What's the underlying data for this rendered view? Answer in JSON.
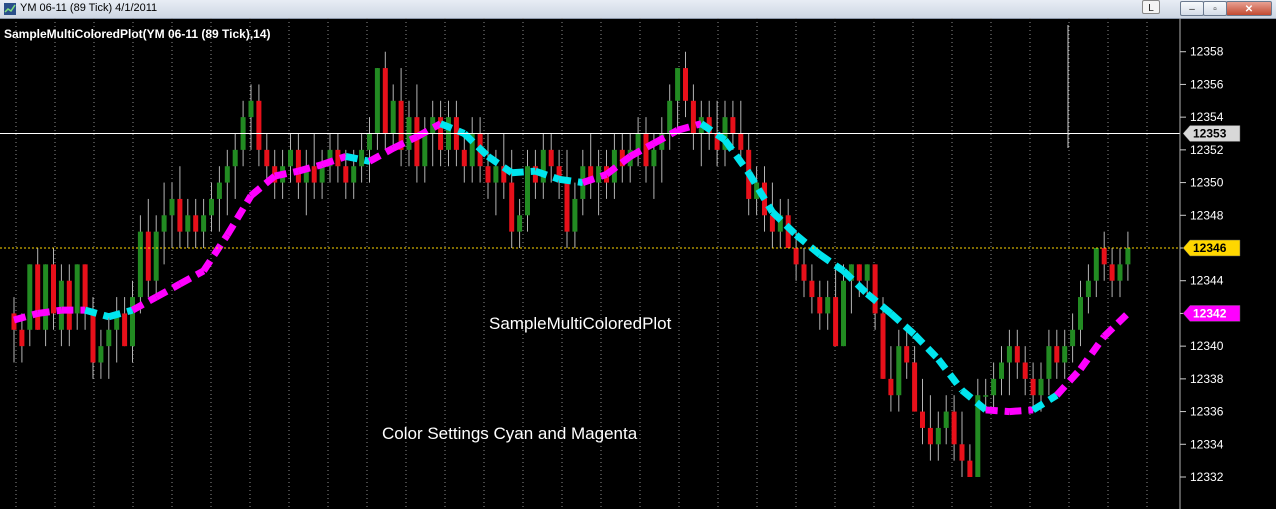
{
  "window": {
    "title": "YM 06-11 (89 Tick)  4/1/2011",
    "btn_l": "L",
    "btn_min": "–",
    "btn_max": "▫",
    "btn_close": "✕"
  },
  "colors": {
    "background": "#000000",
    "up_bar": "#228B22",
    "down_bar": "#E8101A",
    "wick": "#B4B4B4",
    "cyan": "#00E5EE",
    "magenta": "#FF00FF",
    "last_price": "#FFD700",
    "grid": "#8C8C8C",
    "crosshair": "#FFFFFF"
  },
  "chart_data": {
    "type": "candlestick",
    "title": "SampleMultiColoredPlot(YM 06-11 (89 Tick),14)",
    "annotations": [
      "SampleMultiColoredPlot",
      "Color Settings Cyan and Magenta"
    ],
    "ylim": [
      12331.1,
      12359.2
    ],
    "y_ticks": [
      12332,
      12334,
      12336,
      12338,
      12340,
      12342,
      12344,
      12346,
      12348,
      12350,
      12352,
      12354,
      12356,
      12358
    ],
    "y_tick_labels": [
      "12332",
      "12334",
      "12336",
      "12338",
      "12340",
      "12342",
      "12344",
      "12346",
      "12348",
      "12350",
      "12352",
      "12354",
      "12356",
      "12358"
    ],
    "price_markers": [
      {
        "label": "12353",
        "value": 12353,
        "style": "crosshair"
      },
      {
        "label": "12346",
        "value": 12346,
        "style": "last"
      },
      {
        "label": "12342",
        "value": 12342,
        "style": "magenta"
      }
    ],
    "bars": [
      [
        12342,
        12343,
        12339,
        12341
      ],
      [
        12341,
        12342,
        12339,
        12340
      ],
      [
        12341,
        12345,
        12340,
        12345
      ],
      [
        12345,
        12346,
        12341,
        12341
      ],
      [
        12341,
        12345,
        12340,
        12345
      ],
      [
        12345,
        12346,
        12341,
        12342
      ],
      [
        12341,
        12345,
        12340,
        12344
      ],
      [
        12344,
        12345,
        12340,
        12341
      ],
      [
        12342,
        12345,
        12341,
        12345
      ],
      [
        12345,
        12345,
        12341,
        12342
      ],
      [
        12342,
        12343,
        12338,
        12339
      ],
      [
        12339,
        12341,
        12338,
        12340
      ],
      [
        12340,
        12342,
        12338,
        12341
      ],
      [
        12341,
        12343,
        12339,
        12342
      ],
      [
        12342,
        12343,
        12340,
        12340
      ],
      [
        12340,
        12344,
        12339,
        12343
      ],
      [
        12343,
        12348,
        12342,
        12347
      ],
      [
        12347,
        12349,
        12343,
        12344
      ],
      [
        12344,
        12348,
        12343,
        12347
      ],
      [
        12347,
        12350,
        12345,
        12348
      ],
      [
        12348,
        12350,
        12346,
        12349
      ],
      [
        12349,
        12351,
        12346,
        12347
      ],
      [
        12347,
        12349,
        12346,
        12348
      ],
      [
        12348,
        12349,
        12346,
        12347
      ],
      [
        12347,
        12349,
        12346,
        12348
      ],
      [
        12348,
        12350,
        12347,
        12349
      ],
      [
        12349,
        12351,
        12347,
        12350
      ],
      [
        12350,
        12352,
        12348,
        12351
      ],
      [
        12351,
        12353,
        12349,
        12352
      ],
      [
        12352,
        12355,
        12351,
        12354
      ],
      [
        12354,
        12356,
        12352,
        12355
      ],
      [
        12355,
        12356,
        12351,
        12352
      ],
      [
        12352,
        12353,
        12350,
        12351
      ],
      [
        12351,
        12352,
        12349,
        12350
      ],
      [
        12350,
        12352,
        12349,
        12351
      ],
      [
        12351,
        12353,
        12350,
        12352
      ],
      [
        12352,
        12353,
        12349,
        12350
      ],
      [
        12350,
        12352,
        12348,
        12351
      ],
      [
        12351,
        12353,
        12349,
        12350
      ],
      [
        12350,
        12352,
        12349,
        12351
      ],
      [
        12351,
        12353,
        12350,
        12352
      ],
      [
        12352,
        12353,
        12350,
        12351
      ],
      [
        12351,
        12352,
        12349,
        12350
      ],
      [
        12350,
        12352,
        12349,
        12351
      ],
      [
        12351,
        12353,
        12350,
        12352
      ],
      [
        12352,
        12354,
        12350,
        12353
      ],
      [
        12353,
        12357,
        12352,
        12357
      ],
      [
        12357,
        12358,
        12352,
        12353
      ],
      [
        12353,
        12356,
        12352,
        12355
      ],
      [
        12355,
        12357,
        12351,
        12352
      ],
      [
        12352,
        12355,
        12351,
        12354
      ],
      [
        12354,
        12356,
        12350,
        12351
      ],
      [
        12351,
        12354,
        12350,
        12353
      ],
      [
        12353,
        12355,
        12351,
        12354
      ],
      [
        12354,
        12355,
        12351,
        12352
      ],
      [
        12352,
        12355,
        12351,
        12354
      ],
      [
        12354,
        12355,
        12351,
        12352
      ],
      [
        12352,
        12353,
        12350,
        12351
      ],
      [
        12351,
        12354,
        12350,
        12353
      ],
      [
        12353,
        12354,
        12350,
        12351
      ],
      [
        12351,
        12353,
        12349,
        12350
      ],
      [
        12350,
        12352,
        12348,
        12351
      ],
      [
        12351,
        12353,
        12349,
        12350
      ],
      [
        12350,
        12352,
        12346,
        12347
      ],
      [
        12347,
        12349,
        12346,
        12348
      ],
      [
        12348,
        12352,
        12347,
        12351
      ],
      [
        12351,
        12352,
        12349,
        12350
      ],
      [
        12350,
        12353,
        12349,
        12352
      ],
      [
        12352,
        12353,
        12350,
        12351
      ],
      [
        12351,
        12352,
        12349,
        12350
      ],
      [
        12350,
        12352,
        12346,
        12347
      ],
      [
        12347,
        12350,
        12346,
        12349
      ],
      [
        12349,
        12352,
        12348,
        12351
      ],
      [
        12351,
        12353,
        12349,
        12350
      ],
      [
        12350,
        12352,
        12348,
        12351
      ],
      [
        12351,
        12352,
        12349,
        12350
      ],
      [
        12350,
        12353,
        12349,
        12352
      ],
      [
        12352,
        12353,
        12350,
        12351
      ],
      [
        12351,
        12353,
        12350,
        12352
      ],
      [
        12352,
        12354,
        12351,
        12353
      ],
      [
        12353,
        12354,
        12350,
        12351
      ],
      [
        12351,
        12353,
        12349,
        12352
      ],
      [
        12352,
        12354,
        12350,
        12353
      ],
      [
        12353,
        12356,
        12352,
        12355
      ],
      [
        12355,
        12357,
        12353,
        12357
      ],
      [
        12357,
        12358,
        12354,
        12355
      ],
      [
        12355,
        12356,
        12352,
        12353
      ],
      [
        12353,
        12355,
        12351,
        12354
      ],
      [
        12354,
        12355,
        12352,
        12353
      ],
      [
        12353,
        12355,
        12351,
        12352
      ],
      [
        12352,
        12355,
        12351,
        12354
      ],
      [
        12354,
        12355,
        12352,
        12353
      ],
      [
        12353,
        12355,
        12351,
        12352
      ],
      [
        12352,
        12353,
        12348,
        12349
      ],
      [
        12349,
        12351,
        12348,
        12350
      ],
      [
        12350,
        12351,
        12347,
        12348
      ],
      [
        12348,
        12350,
        12346,
        12347
      ],
      [
        12347,
        12349,
        12346,
        12348
      ],
      [
        12348,
        12349,
        12346,
        12346
      ],
      [
        12346,
        12347,
        12344,
        12345
      ],
      [
        12345,
        12346,
        12343,
        12344
      ],
      [
        12344,
        12345,
        12342,
        12343
      ],
      [
        12343,
        12344,
        12341,
        12342
      ],
      [
        12342,
        12344,
        12341,
        12343
      ],
      [
        12343,
        12345,
        12340,
        12340
      ],
      [
        12340,
        12345,
        12340,
        12344
      ],
      [
        12344,
        12345,
        12342,
        12345
      ],
      [
        12345,
        12345,
        12343,
        12344
      ],
      [
        12344,
        12345,
        12343,
        12345
      ],
      [
        12345,
        12345,
        12341,
        12342
      ],
      [
        12342,
        12343,
        12338,
        12338
      ],
      [
        12338,
        12340,
        12336,
        12337
      ],
      [
        12337,
        12341,
        12336,
        12340
      ],
      [
        12340,
        12341,
        12338,
        12339
      ],
      [
        12339,
        12340,
        12336,
        12336
      ],
      [
        12336,
        12338,
        12334,
        12335
      ],
      [
        12335,
        12337,
        12333,
        12334
      ],
      [
        12334,
        12336,
        12333,
        12335
      ],
      [
        12335,
        12337,
        12334,
        12336
      ],
      [
        12336,
        12337,
        12333,
        12334
      ],
      [
        12334,
        12336,
        12332,
        12333
      ],
      [
        12333,
        12334,
        12332,
        12332
      ],
      [
        12332,
        12338,
        12332,
        12337
      ],
      [
        12337,
        12338,
        12336,
        12337
      ],
      [
        12337,
        12339,
        12336,
        12338
      ],
      [
        12338,
        12340,
        12337,
        12339
      ],
      [
        12339,
        12341,
        12337,
        12340
      ],
      [
        12340,
        12341,
        12338,
        12339
      ],
      [
        12339,
        12340,
        12337,
        12338
      ],
      [
        12338,
        12339,
        12336,
        12337
      ],
      [
        12337,
        12339,
        12336,
        12338
      ],
      [
        12338,
        12341,
        12337,
        12340
      ],
      [
        12340,
        12341,
        12338,
        12339
      ],
      [
        12339,
        12341,
        12338,
        12340
      ],
      [
        12340,
        12342,
        12339,
        12341
      ],
      [
        12341,
        12344,
        12340,
        12343
      ],
      [
        12343,
        12345,
        12342,
        12344
      ],
      [
        12344,
        12346,
        12343,
        12346
      ],
      [
        12346,
        12347,
        12344,
        12345
      ],
      [
        12345,
        12346,
        12343,
        12344
      ],
      [
        12344,
        12346,
        12343,
        12345
      ],
      [
        12345,
        12347,
        12344,
        12346
      ]
    ],
    "ma_line": [
      {
        "x": 0,
        "y": 12341.6,
        "color": "magenta"
      },
      {
        "x": 3,
        "y": 12342.0,
        "color": "magenta"
      },
      {
        "x": 6,
        "y": 12342.2,
        "color": "magenta"
      },
      {
        "x": 9,
        "y": 12342.2,
        "color": "cyan"
      },
      {
        "x": 12,
        "y": 12341.8,
        "color": "cyan"
      },
      {
        "x": 15,
        "y": 12342.2,
        "color": "magenta"
      },
      {
        "x": 18,
        "y": 12343.0,
        "color": "magenta"
      },
      {
        "x": 21,
        "y": 12343.8,
        "color": "magenta"
      },
      {
        "x": 24,
        "y": 12344.6,
        "color": "magenta"
      },
      {
        "x": 27,
        "y": 12346.8,
        "color": "magenta"
      },
      {
        "x": 30,
        "y": 12349.2,
        "color": "magenta"
      },
      {
        "x": 33,
        "y": 12350.4,
        "color": "magenta"
      },
      {
        "x": 36,
        "y": 12350.7,
        "color": "magenta"
      },
      {
        "x": 39,
        "y": 12351.1,
        "color": "magenta"
      },
      {
        "x": 42,
        "y": 12351.6,
        "color": "cyan"
      },
      {
        "x": 45,
        "y": 12351.3,
        "color": "magenta"
      },
      {
        "x": 48,
        "y": 12352.1,
        "color": "magenta"
      },
      {
        "x": 51,
        "y": 12352.8,
        "color": "magenta"
      },
      {
        "x": 54,
        "y": 12353.6,
        "color": "cyan"
      },
      {
        "x": 57,
        "y": 12353.0,
        "color": "cyan"
      },
      {
        "x": 60,
        "y": 12351.6,
        "color": "cyan"
      },
      {
        "x": 63,
        "y": 12350.6,
        "color": "cyan"
      },
      {
        "x": 66,
        "y": 12350.7,
        "color": "cyan"
      },
      {
        "x": 69,
        "y": 12350.2,
        "color": "cyan"
      },
      {
        "x": 72,
        "y": 12350.0,
        "color": "magenta"
      },
      {
        "x": 75,
        "y": 12350.5,
        "color": "magenta"
      },
      {
        "x": 78,
        "y": 12351.6,
        "color": "magenta"
      },
      {
        "x": 81,
        "y": 12352.4,
        "color": "magenta"
      },
      {
        "x": 84,
        "y": 12353.2,
        "color": "magenta"
      },
      {
        "x": 87,
        "y": 12353.6,
        "color": "cyan"
      },
      {
        "x": 90,
        "y": 12352.6,
        "color": "cyan"
      },
      {
        "x": 93,
        "y": 12350.6,
        "color": "cyan"
      },
      {
        "x": 96,
        "y": 12348.2,
        "color": "cyan"
      },
      {
        "x": 99,
        "y": 12346.8,
        "color": "cyan"
      },
      {
        "x": 102,
        "y": 12345.6,
        "color": "cyan"
      },
      {
        "x": 105,
        "y": 12344.6,
        "color": "cyan"
      },
      {
        "x": 108,
        "y": 12343.2,
        "color": "cyan"
      },
      {
        "x": 111,
        "y": 12342.0,
        "color": "cyan"
      },
      {
        "x": 114,
        "y": 12340.7,
        "color": "cyan"
      },
      {
        "x": 117,
        "y": 12339.2,
        "color": "cyan"
      },
      {
        "x": 120,
        "y": 12337.3,
        "color": "cyan"
      },
      {
        "x": 123,
        "y": 12336.1,
        "color": "magenta"
      },
      {
        "x": 126,
        "y": 12336.0,
        "color": "magenta"
      },
      {
        "x": 129,
        "y": 12336.1,
        "color": "cyan"
      },
      {
        "x": 132,
        "y": 12337.0,
        "color": "magenta"
      },
      {
        "x": 135,
        "y": 12338.6,
        "color": "magenta"
      },
      {
        "x": 138,
        "y": 12340.6,
        "color": "magenta"
      },
      {
        "x": 141,
        "y": 12342.0,
        "color": "magenta"
      }
    ]
  }
}
